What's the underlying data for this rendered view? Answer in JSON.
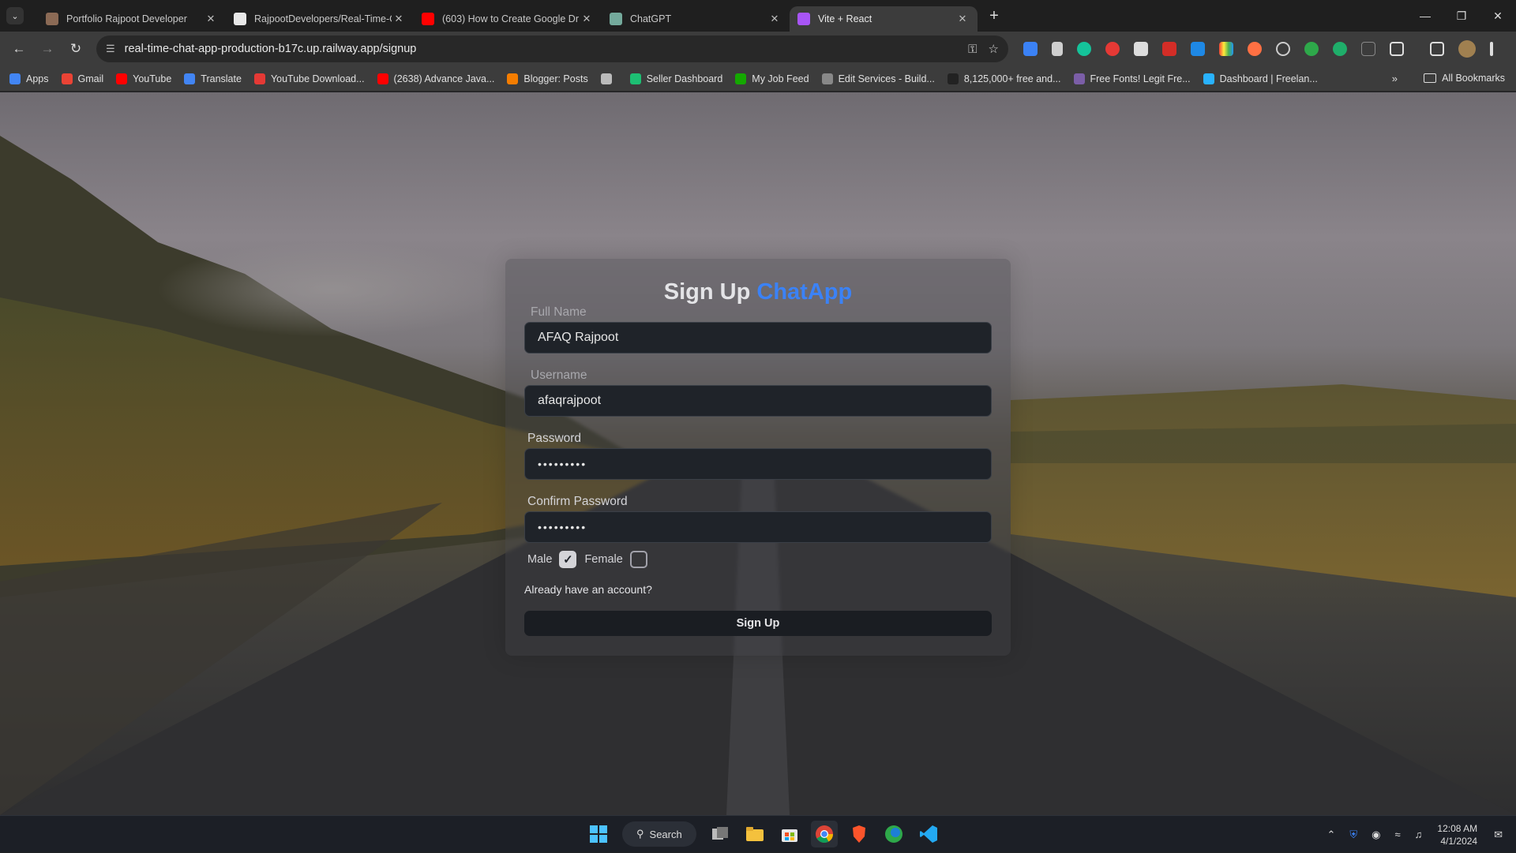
{
  "browser": {
    "tabs": [
      {
        "title": "Portfolio Rajpoot Developer",
        "active": false,
        "favicon": "portfolio-favicon",
        "color": "#8b6a55"
      },
      {
        "title": "RajpootDevelopers/Real-Time-C",
        "active": false,
        "favicon": "github-favicon",
        "color": "#e8e8e8"
      },
      {
        "title": "(603) How to Create Google Dr",
        "active": false,
        "favicon": "youtube-favicon",
        "color": "#ff0000"
      },
      {
        "title": "ChatGPT",
        "active": false,
        "favicon": "chatgpt-favicon",
        "color": "#74aa9c"
      },
      {
        "title": "Vite + React",
        "active": true,
        "favicon": "vite-favicon",
        "color": "#a855f7"
      }
    ],
    "url": "real-time-chat-app-production-b17c.up.railway.app/signup",
    "bookmarks": [
      {
        "label": "Apps",
        "icon": "apps-grid-icon",
        "color": "#4285f4"
      },
      {
        "label": "Gmail",
        "icon": "gmail-icon",
        "color": "#ea4335"
      },
      {
        "label": "YouTube",
        "icon": "youtube-icon",
        "color": "#ff0000"
      },
      {
        "label": "Translate",
        "icon": "translate-icon",
        "color": "#4285f4"
      },
      {
        "label": "YouTube Download...",
        "icon": "download-icon",
        "color": "#e53935"
      },
      {
        "label": "(2638) Advance Java...",
        "icon": "youtube-icon",
        "color": "#ff0000"
      },
      {
        "label": "Blogger: Posts",
        "icon": "blogger-icon",
        "color": "#f57d00"
      },
      {
        "label": "",
        "icon": "globe-icon",
        "color": "#bbbbbb"
      },
      {
        "label": "Seller Dashboard",
        "icon": "fiverr-icon",
        "color": "#1dbf73"
      },
      {
        "label": "My Job Feed",
        "icon": "upwork-icon",
        "color": "#14a800"
      },
      {
        "label": "Edit Services - Build...",
        "icon": "service-icon",
        "color": "#888888"
      },
      {
        "label": "8,125,000+ free and...",
        "icon": "vector-icon",
        "color": "#222222"
      },
      {
        "label": "Free Fonts! Legit Fre...",
        "icon": "fonts-icon",
        "color": "#7b5ea7"
      },
      {
        "label": "Dashboard | Freelan...",
        "icon": "freelancer-icon",
        "color": "#29b2fe"
      }
    ],
    "all_bookmarks_label": "All Bookmarks"
  },
  "form": {
    "title": "Sign Up",
    "brand": "ChatApp",
    "brand_color": "#3b82f6",
    "fields": {
      "fullname": {
        "label": "Full Name",
        "value": "AFAQ Rajpoot"
      },
      "username": {
        "label": "Username",
        "value": "afaqrajpoot"
      },
      "password": {
        "label": "Password",
        "value": "•••••••••"
      },
      "confirm": {
        "label": "Confirm Password",
        "value": "•••••••••"
      }
    },
    "gender": {
      "male_label": "Male",
      "male_checked": true,
      "female_label": "Female",
      "female_checked": false
    },
    "login_link": "Already have an account?",
    "submit_label": "Sign Up"
  },
  "taskbar": {
    "search_label": "Search",
    "time": "12:08 AM",
    "date": "4/1/2024"
  }
}
